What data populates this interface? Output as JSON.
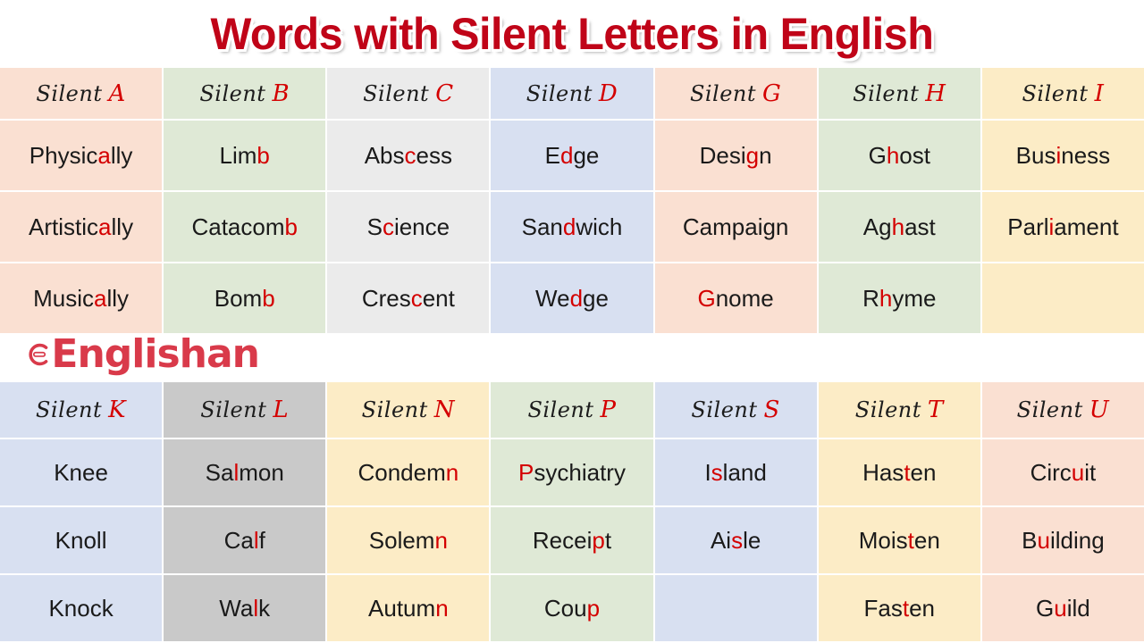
{
  "title": "Words with Silent Letters in English",
  "brand": {
    "name": "Englishan",
    "color": "#d93a4a"
  },
  "accent_red": "#d40000",
  "header_prefix": "Silent",
  "tables": [
    {
      "id": "table-top",
      "columns": [
        {
          "letter": "A",
          "header": "Silent A",
          "tint": "c-peach",
          "words": [
            {
              "pre": "Physic",
              "sil": "a",
              "post": "lly"
            },
            {
              "pre": "Artistic",
              "sil": "a",
              "post": "lly"
            },
            {
              "pre": "Music",
              "sil": "a",
              "post": "lly"
            }
          ]
        },
        {
          "letter": "B",
          "header": "Silent B",
          "tint": "c-green",
          "words": [
            {
              "pre": "Lim",
              "sil": "b",
              "post": ""
            },
            {
              "pre": "Catacom",
              "sil": "b",
              "post": ""
            },
            {
              "pre": "Bom",
              "sil": "b",
              "post": ""
            }
          ]
        },
        {
          "letter": "C",
          "header": "Silent C",
          "tint": "c-grey",
          "words": [
            {
              "pre": "Abs",
              "sil": "c",
              "post": "ess"
            },
            {
              "pre": "S",
              "sil": "c",
              "post": "ience"
            },
            {
              "pre": "Cres",
              "sil": "c",
              "post": "ent"
            }
          ]
        },
        {
          "letter": "D",
          "header": "Silent D",
          "tint": "c-blue",
          "words": [
            {
              "pre": "E",
              "sil": "d",
              "post": "ge"
            },
            {
              "pre": "San",
              "sil": "d",
              "post": "wich"
            },
            {
              "pre": "We",
              "sil": "d",
              "post": "ge"
            }
          ]
        },
        {
          "letter": "G",
          "header": "Silent G",
          "tint": "c-peach",
          "words": [
            {
              "pre": "Desi",
              "sil": "g",
              "post": "n"
            },
            {
              "pre": "Campaign",
              "sil": "",
              "post": ""
            },
            {
              "pre": "",
              "sil": "G",
              "post": "nome"
            }
          ]
        },
        {
          "letter": "H",
          "header": "Silent H",
          "tint": "c-green",
          "words": [
            {
              "pre": "G",
              "sil": "h",
              "post": "ost"
            },
            {
              "pre": "Ag",
              "sil": "h",
              "post": "ast"
            },
            {
              "pre": "R",
              "sil": "h",
              "post": "yme"
            }
          ]
        },
        {
          "letter": "I",
          "header": "Silent I",
          "tint": "c-cream",
          "words": [
            {
              "pre": "Bus",
              "sil": "i",
              "post": "ness"
            },
            {
              "pre": "Parl",
              "sil": "i",
              "post": "ament"
            },
            {
              "pre": "",
              "sil": "",
              "post": ""
            }
          ]
        }
      ]
    },
    {
      "id": "table-bottom",
      "columns": [
        {
          "letter": "K",
          "header": "Silent K",
          "tint": "c-blue",
          "words": [
            {
              "pre": "Knee",
              "sil": "",
              "post": ""
            },
            {
              "pre": "Knoll",
              "sil": "",
              "post": ""
            },
            {
              "pre": "Knock",
              "sil": "",
              "post": ""
            }
          ]
        },
        {
          "letter": "L",
          "header": "Silent L",
          "tint": "c-dgrey",
          "words": [
            {
              "pre": "Sa",
              "sil": "l",
              "post": "mon"
            },
            {
              "pre": "Ca",
              "sil": "l",
              "post": "f"
            },
            {
              "pre": "Wa",
              "sil": "l",
              "post": "k"
            }
          ]
        },
        {
          "letter": "N",
          "header": "Silent N",
          "tint": "c-cream",
          "words": [
            {
              "pre": "Condem",
              "sil": "n",
              "post": ""
            },
            {
              "pre": "Solem",
              "sil": "n",
              "post": ""
            },
            {
              "pre": "Autum",
              "sil": "n",
              "post": ""
            }
          ]
        },
        {
          "letter": "P",
          "header": "Silent P",
          "tint": "c-green",
          "words": [
            {
              "pre": "",
              "sil": "P",
              "post": "sychiatry"
            },
            {
              "pre": "Recei",
              "sil": "p",
              "post": "t"
            },
            {
              "pre": "Cou",
              "sil": "p",
              "post": ""
            }
          ]
        },
        {
          "letter": "S",
          "header": "Silent S",
          "tint": "c-blue",
          "words": [
            {
              "pre": "I",
              "sil": "s",
              "post": "land"
            },
            {
              "pre": "Ai",
              "sil": "s",
              "post": "le"
            },
            {
              "pre": "",
              "sil": "",
              "post": ""
            }
          ]
        },
        {
          "letter": "T",
          "header": "Silent T",
          "tint": "c-cream",
          "words": [
            {
              "pre": "Has",
              "sil": "t",
              "post": "en"
            },
            {
              "pre": "Mois",
              "sil": "t",
              "post": "en"
            },
            {
              "pre": "Fas",
              "sil": "t",
              "post": "en"
            }
          ]
        },
        {
          "letter": "U",
          "header": "Silent U",
          "tint": "c-peach",
          "words": [
            {
              "pre": "Circ",
              "sil": "u",
              "post": "it"
            },
            {
              "pre": "B",
              "sil": "u",
              "post": "ilding"
            },
            {
              "pre": "G",
              "sil": "u",
              "post": "ild"
            }
          ]
        }
      ]
    }
  ]
}
